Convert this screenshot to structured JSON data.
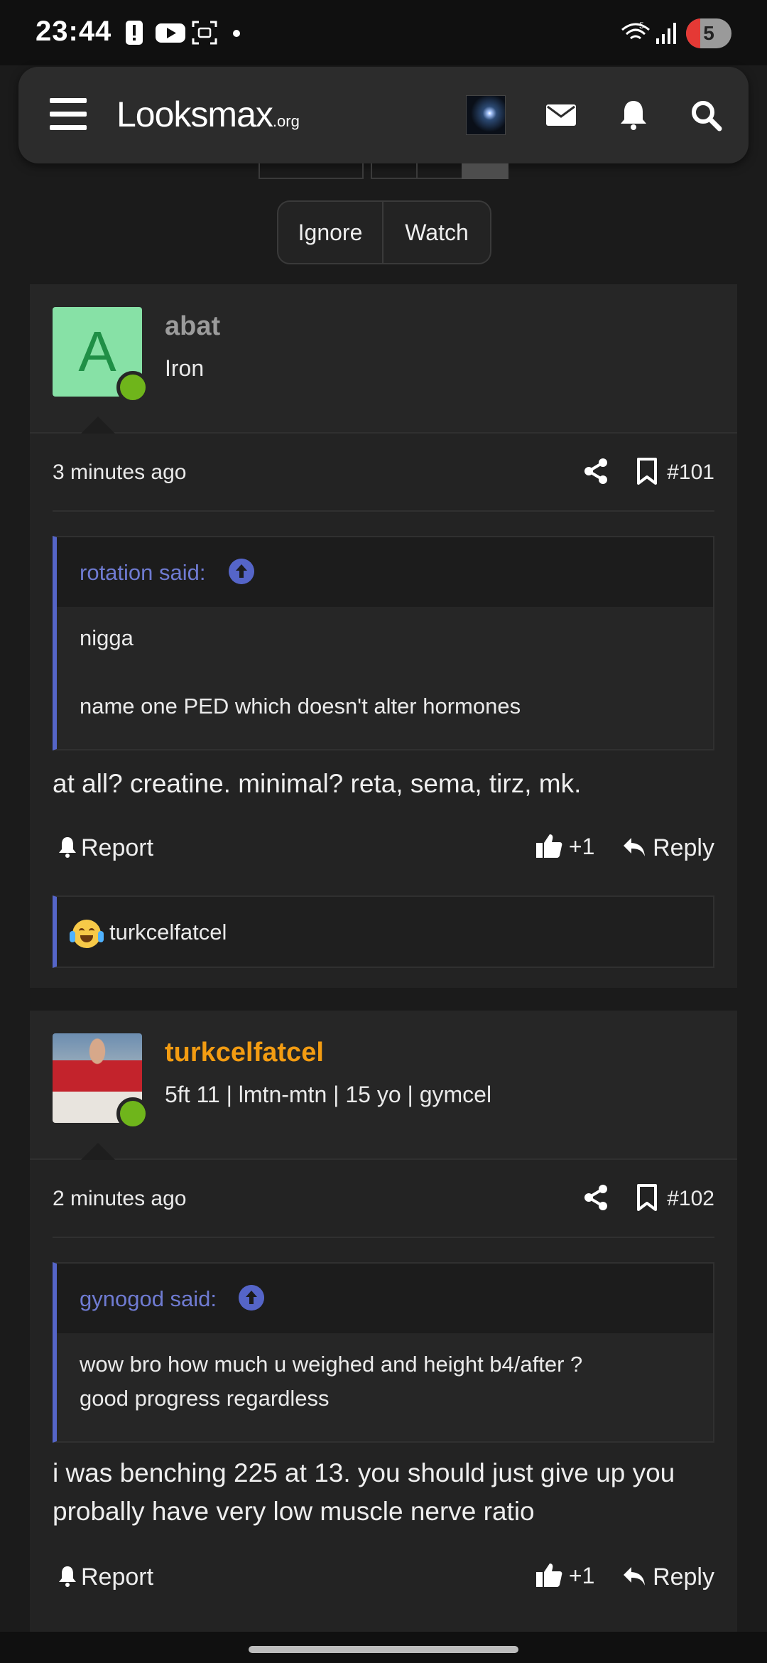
{
  "status_bar": {
    "time": "23:44",
    "wifi_badge": "5",
    "battery_level": "5"
  },
  "header": {
    "logo_main": "Looksmax",
    "logo_suffix": ".org",
    "icons": [
      "menu-icon",
      "user-avatar",
      "mail-icon",
      "bell-icon",
      "search-icon"
    ]
  },
  "thread_controls": {
    "ignore_label": "Ignore",
    "watch_label": "Watch"
  },
  "posts": [
    {
      "username": "abat",
      "username_color": "#9b9b9b",
      "avatar_letter": "A",
      "user_title": "Iron",
      "time_ago": "3 minutes ago",
      "post_number": "#101",
      "quote": {
        "author": "rotation said:",
        "lines": [
          "nigga",
          "name one PED which doesn't alter hormones"
        ]
      },
      "content": "at all? creatine. minimal? reta, sema, tirz, mk.",
      "report_label": "Report",
      "like_label": "+1",
      "reply_label": "Reply",
      "reaction_user": "turkcelfatcel"
    },
    {
      "username": "turkcelfatcel",
      "username_color": "#f39c12",
      "user_title": "5ft 11 | lmtn-mtn | 15 yo | gymcel",
      "time_ago": "2 minutes ago",
      "post_number": "#102",
      "quote": {
        "author": "gynogod said:",
        "lines": [
          "wow bro how much u weighed and height b4/after ?",
          "good progress regardless"
        ]
      },
      "content_lines": [
        "i was benching 225 at 13. you should just give up you",
        "probally have very low muscle nerve ratio"
      ],
      "report_label": "Report",
      "like_label": "+1",
      "reply_label": "Reply"
    }
  ],
  "colors": {
    "accent_quote": "#5565c8",
    "online_dot": "#6fb51b",
    "background": "#1b1b1b"
  }
}
